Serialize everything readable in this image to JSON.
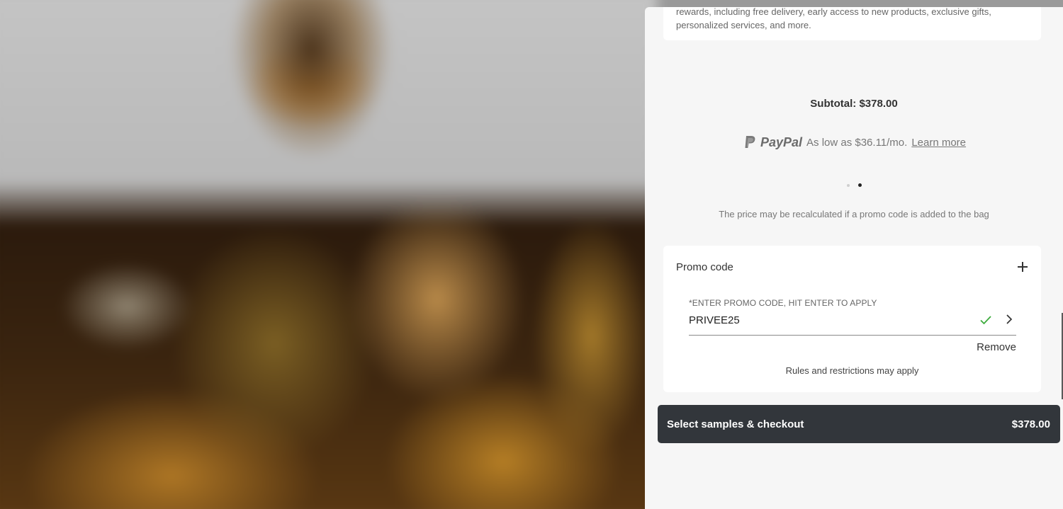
{
  "rewards": {
    "text": "rewards, including free delivery, early access to new products, exclusive gifts, personalized services, and more."
  },
  "summary": {
    "subtotal": "Subtotal: $378.00"
  },
  "paypal": {
    "brand": "PayPal",
    "offer": "As low as $36.11/mo.",
    "learn_more": "Learn more"
  },
  "carousel": {
    "dots": 2,
    "active_index": 1
  },
  "price_note": "The price may be recalculated if a promo code is added to the bag",
  "promo": {
    "title": "Promo code",
    "field_label": "*ENTER PROMO CODE, HIT ENTER TO APPLY",
    "value": "PRIVEE25",
    "remove_label": "Remove",
    "rules": "Rules and restrictions may apply"
  },
  "checkout": {
    "label": "Select samples & checkout",
    "price": "$378.00"
  },
  "colors": {
    "panel_bg": "#f6f6f6",
    "button_bg": "#32363b",
    "success_check": "#3bab3b"
  },
  "icons": [
    "paypal-logo-icon",
    "plus-icon",
    "check-icon",
    "chevron-right-icon"
  ]
}
